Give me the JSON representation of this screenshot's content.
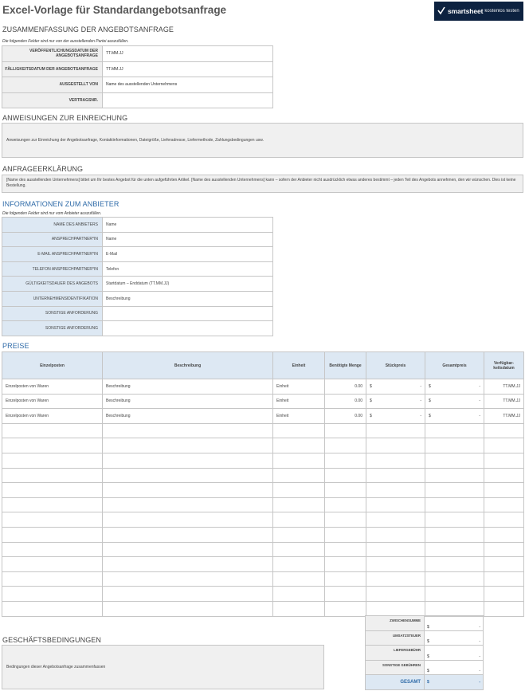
{
  "title": "Excel-Vorlage für Standardangebotsanfrage",
  "logo": {
    "name": "smartsheet",
    "tagline": "kostenlos testen"
  },
  "summary": {
    "heading": "ZUSAMMENFASSUNG DER ANGEBOTSANFRAGE",
    "note": "Die folgenden Felder sind nur von der ausstellenden Partei auszufüllen.",
    "rows": [
      {
        "label": "VERÖFFENTLICHUNGSDATUM DER ANGEBOTSANFRAGE",
        "value": "TT.MM.JJ"
      },
      {
        "label": "FÄLLIGKEITSDATUM DER ANGEBOTSANFRAGE",
        "value": "TT.MM.JJ"
      },
      {
        "label": "AUSGESTELLT VON",
        "value": "Name des ausstellenden Unternehmens"
      },
      {
        "label": "VERTRAGSNR.",
        "value": ""
      }
    ]
  },
  "instructions": {
    "heading": "ANWEISUNGEN ZUR EINREICHUNG",
    "text": "Anweisungen zur Einreichung der Angebotsanfrage, Kontaktinformationen, Dateigröße, Lieferadresse, Liefermethode, Zahlungsbedingungen usw."
  },
  "declaration": {
    "heading": "ANFRAGEERKLÄRUNG",
    "text": "[Name des ausstellenden Unternehmens] bittet um Ihr bestes Angebot für die unten aufgeführten Artikel. [Name des ausstellenden Unternehmens] kann – sofern der Anbieter nicht ausdrücklich etwas anderes bestimmt – jeden Teil des Angebots annehmen, den wir wünschen. Dies ist keine Bestellung."
  },
  "vendor": {
    "heading": "INFORMATIONEN ZUM ANBIETER",
    "note": "Die folgenden Felder sind nur vom Anbieter auszufüllen.",
    "rows": [
      {
        "label": "NAME DES ANBIETERS",
        "value": "Name"
      },
      {
        "label": "ANSPRECHPARTNER*IN",
        "value": "Name"
      },
      {
        "label": "E-MAIL ANSPRECHPARTNER*IN",
        "value": "E-Mail"
      },
      {
        "label": "TELEFON ANSPRECHPARTNER*IN",
        "value": "Telefon"
      },
      {
        "label": "GÜLTIGKEITSDAUER DES ANGEBOTS",
        "value": "Startdatum – Enddatum (TT.MM.JJ)"
      },
      {
        "label": "UNTERNEHMENSIDENTIFIKATION",
        "value": "Beschreibung"
      },
      {
        "label": "SONSTIGE ANFORDERUNG",
        "value": ""
      },
      {
        "label": "SONSTIGE ANFORDERUNG",
        "value": ""
      }
    ]
  },
  "pricing": {
    "heading": "PREISE",
    "columns": [
      "Einzelposten",
      "Beschreibung",
      "Einheit",
      "Benötigte Menge",
      "Stückpreis",
      "Gesamtpreis",
      "Verfügbar-keitsdatum"
    ],
    "currency": "$",
    "rows": [
      {
        "item": "Einzelposten von Waren",
        "desc": "Beschreibung",
        "unit": "Einheit",
        "qty": "0.00",
        "unit_price": "-",
        "total": "-",
        "date": "TT.MM.JJ"
      },
      {
        "item": "Einzelposten von Waren",
        "desc": "Beschreibung",
        "unit": "Einheit",
        "qty": "0.00",
        "unit_price": "-",
        "total": "-",
        "date": "TT.MM.JJ"
      },
      {
        "item": "Einzelposten von Waren",
        "desc": "Beschreibung",
        "unit": "Einheit",
        "qty": "0.00",
        "unit_price": "-",
        "total": "-",
        "date": "TT.MM.JJ"
      }
    ],
    "empty_rows": 13
  },
  "totals": [
    {
      "label": "ZWISCHENSUMME",
      "currency": "$",
      "value": "-"
    },
    {
      "label": "UMSATZSTEUER",
      "currency": "$",
      "value": "-"
    },
    {
      "label": "LIEFERGEBÜHR",
      "currency": "$",
      "value": "-"
    },
    {
      "label": "SONSTIGE GEBÜHREN",
      "currency": "$",
      "value": "-"
    },
    {
      "label": "GESAMT",
      "currency": "$",
      "value": "-"
    }
  ],
  "terms": {
    "heading": "GESCHÄFTSBEDINGUNGEN",
    "text": "Bedingungen dieser Angebotsanfrage zusammenfassen"
  }
}
